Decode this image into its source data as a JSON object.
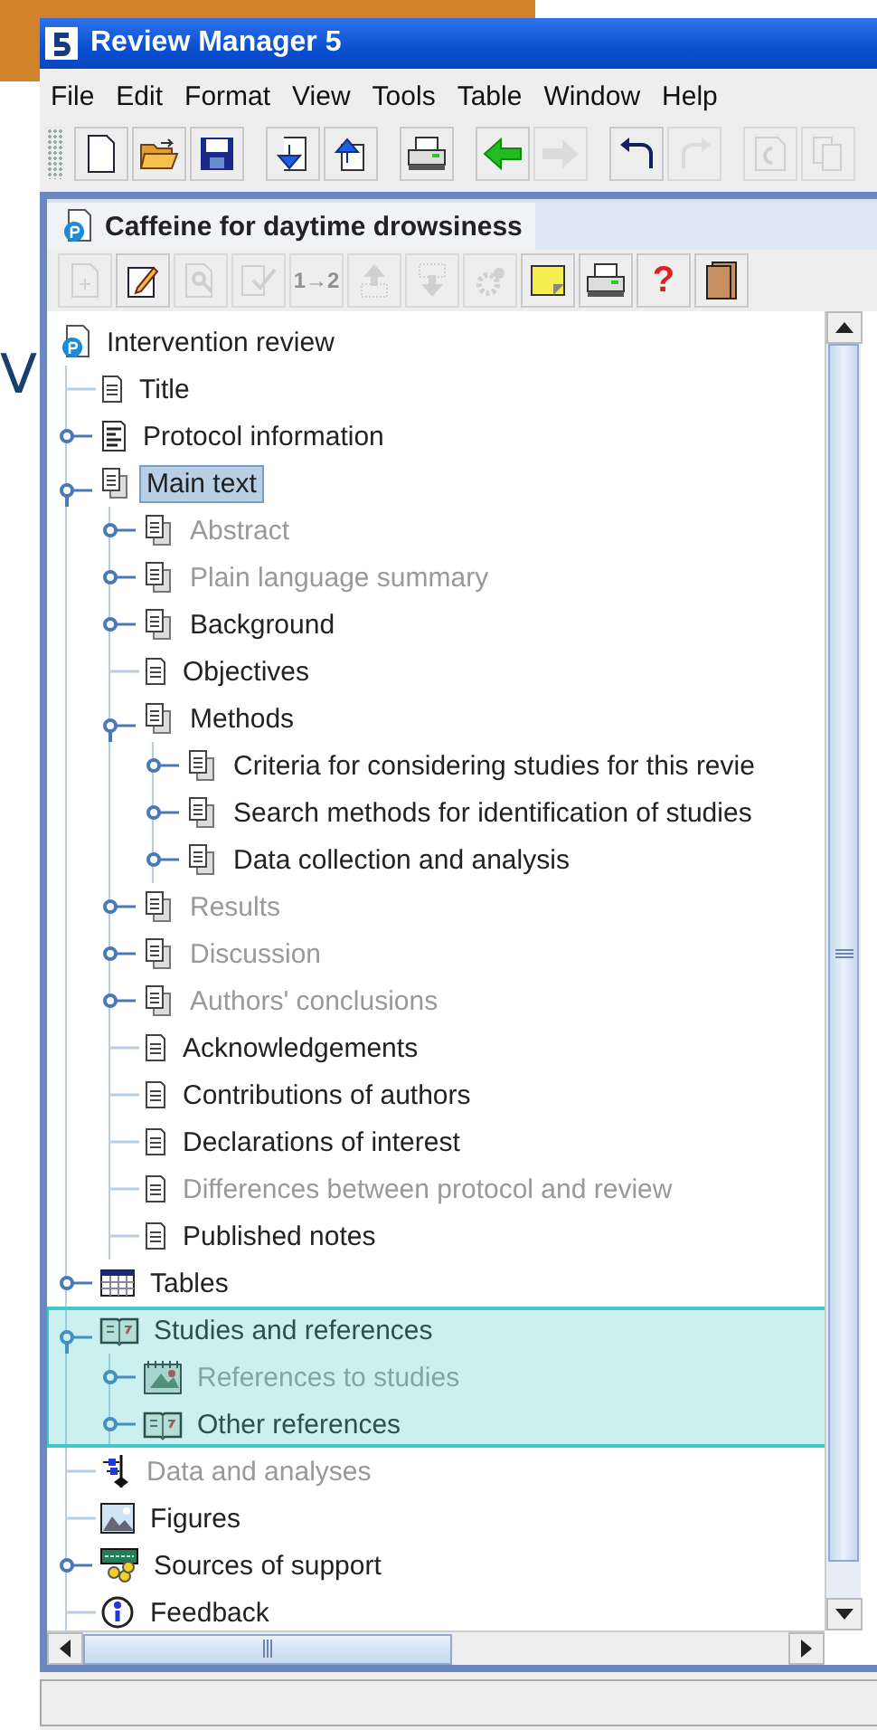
{
  "slide": {
    "heading_fragment": "V"
  },
  "window": {
    "title": "Review Manager 5"
  },
  "menu": [
    "File",
    "Edit",
    "Format",
    "View",
    "Tools",
    "Table",
    "Window",
    "Help"
  ],
  "toolbar": [
    {
      "kind": "new",
      "disabled": false
    },
    {
      "kind": "open",
      "disabled": false
    },
    {
      "kind": "save",
      "disabled": false
    },
    {
      "kind": "import",
      "disabled": false
    },
    {
      "kind": "export",
      "disabled": false
    },
    {
      "kind": "print",
      "disabled": false
    },
    {
      "kind": "back",
      "disabled": false
    },
    {
      "kind": "forward",
      "disabled": true
    },
    {
      "kind": "undo",
      "disabled": false
    },
    {
      "kind": "redo",
      "disabled": true
    },
    {
      "kind": "copy",
      "disabled": true
    },
    {
      "kind": "paste",
      "disabled": true
    }
  ],
  "document": {
    "title": "Caffeine for daytime drowsiness",
    "toolbar": [
      {
        "kind": "add",
        "disabled": true
      },
      {
        "kind": "edit",
        "disabled": false
      },
      {
        "kind": "find",
        "disabled": true
      },
      {
        "kind": "check",
        "disabled": true
      },
      {
        "kind": "text",
        "label": "1→2",
        "disabled": true
      },
      {
        "kind": "up",
        "disabled": true
      },
      {
        "kind": "down",
        "disabled": true
      },
      {
        "kind": "gear",
        "disabled": true
      },
      {
        "kind": "note",
        "disabled": false
      },
      {
        "kind": "print",
        "disabled": false
      },
      {
        "kind": "text",
        "label": "?",
        "disabled": false
      },
      {
        "kind": "book",
        "disabled": false
      }
    ],
    "tree": {
      "label": "Intervention review",
      "kind": "review",
      "disabled": false,
      "selected": false,
      "children": [
        {
          "label": "Title",
          "kind": "doc",
          "disabled": false,
          "selected": false,
          "expandable": false
        },
        {
          "label": "Protocol information",
          "kind": "protocol",
          "disabled": false,
          "selected": false,
          "expandable": true,
          "expanded": false
        },
        {
          "label": "Main text",
          "kind": "docs",
          "disabled": false,
          "selected": true,
          "expandable": true,
          "expanded": true,
          "children": [
            {
              "label": "Abstract",
              "kind": "docs",
              "disabled": true,
              "selected": false,
              "expandable": true,
              "expanded": false
            },
            {
              "label": "Plain language summary",
              "kind": "docs",
              "disabled": true,
              "selected": false,
              "expandable": true,
              "expanded": false
            },
            {
              "label": "Background",
              "kind": "docs",
              "disabled": false,
              "selected": false,
              "expandable": true,
              "expanded": false
            },
            {
              "label": "Objectives",
              "kind": "doc",
              "disabled": false,
              "selected": false,
              "expandable": false
            },
            {
              "label": "Methods",
              "kind": "docs",
              "disabled": false,
              "selected": false,
              "expandable": true,
              "expanded": true,
              "children": [
                {
                  "label": "Criteria for considering studies for this revie",
                  "kind": "docs",
                  "disabled": false,
                  "selected": false,
                  "expandable": true,
                  "expanded": false
                },
                {
                  "label": "Search methods for identification of studies",
                  "kind": "docs",
                  "disabled": false,
                  "selected": false,
                  "expandable": true,
                  "expanded": false
                },
                {
                  "label": "Data collection and analysis",
                  "kind": "docs",
                  "disabled": false,
                  "selected": false,
                  "expandable": true,
                  "expanded": false
                }
              ]
            },
            {
              "label": "Results",
              "kind": "docs",
              "disabled": true,
              "selected": false,
              "expandable": true,
              "expanded": false
            },
            {
              "label": "Discussion",
              "kind": "docs",
              "disabled": true,
              "selected": false,
              "expandable": true,
              "expanded": false
            },
            {
              "label": "Authors' conclusions",
              "kind": "docs",
              "disabled": true,
              "selected": false,
              "expandable": true,
              "expanded": false
            },
            {
              "label": "Acknowledgements",
              "kind": "doc",
              "disabled": false,
              "selected": false,
              "expandable": false
            },
            {
              "label": "Contributions of authors",
              "kind": "doc",
              "disabled": false,
              "selected": false,
              "expandable": false
            },
            {
              "label": "Declarations of interest",
              "kind": "doc",
              "disabled": false,
              "selected": false,
              "expandable": false
            },
            {
              "label": "Differences between protocol and review",
              "kind": "doc",
              "disabled": true,
              "selected": false,
              "expandable": false
            },
            {
              "label": "Published notes",
              "kind": "doc",
              "disabled": false,
              "selected": false,
              "expandable": false
            }
          ]
        },
        {
          "label": "Tables",
          "kind": "table",
          "disabled": false,
          "selected": false,
          "expandable": true,
          "expanded": false
        },
        {
          "label": "Studies and references",
          "kind": "book",
          "disabled": false,
          "selected": false,
          "expandable": true,
          "expanded": true,
          "highlighted": true,
          "children": [
            {
              "label": "References to studies",
              "kind": "studies",
              "disabled": true,
              "selected": false,
              "expandable": true,
              "expanded": false
            },
            {
              "label": "Other references",
              "kind": "book",
              "disabled": false,
              "selected": false,
              "expandable": true,
              "expanded": false
            }
          ]
        },
        {
          "label": "Data and analyses",
          "kind": "analyses",
          "disabled": true,
          "selected": false,
          "expandable": false
        },
        {
          "label": "Figures",
          "kind": "figure",
          "disabled": false,
          "selected": false,
          "expandable": false
        },
        {
          "label": "Sources of support",
          "kind": "support",
          "disabled": false,
          "selected": false,
          "expandable": true,
          "expanded": false
        },
        {
          "label": "Feedback",
          "kind": "feedback",
          "disabled": false,
          "selected": false,
          "expandable": false
        }
      ]
    }
  }
}
